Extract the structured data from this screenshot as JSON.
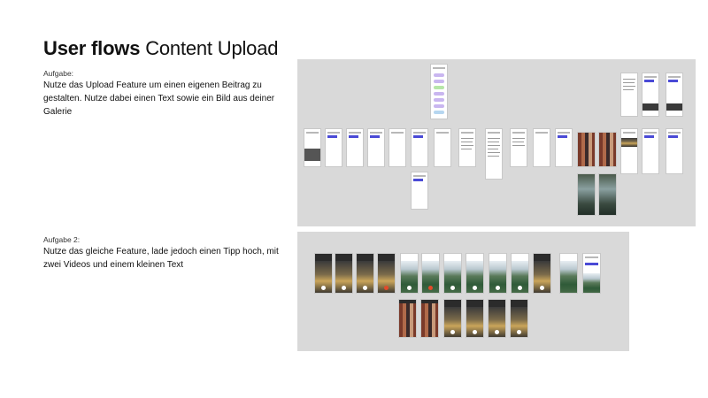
{
  "header": {
    "title_bold": "User flows",
    "title_light": "Content Upload"
  },
  "task1": {
    "label": "Aufgabe:",
    "text": "Nutze das Upload Feature um einen eigenen Beitrag zu gestalten. Nutze dabei einen Text sowie ein Bild aus deiner Galerie"
  },
  "task2": {
    "label": "Aufgabe 2:",
    "text": "Nutze das gleiche Feature, lade jedoch einen Tipp hoch, mit zwei Videos und einem kleinen Text"
  },
  "colors": {
    "board": "#d9d9d9",
    "accent": "#4a4ad6",
    "record": "#e24a2a"
  }
}
